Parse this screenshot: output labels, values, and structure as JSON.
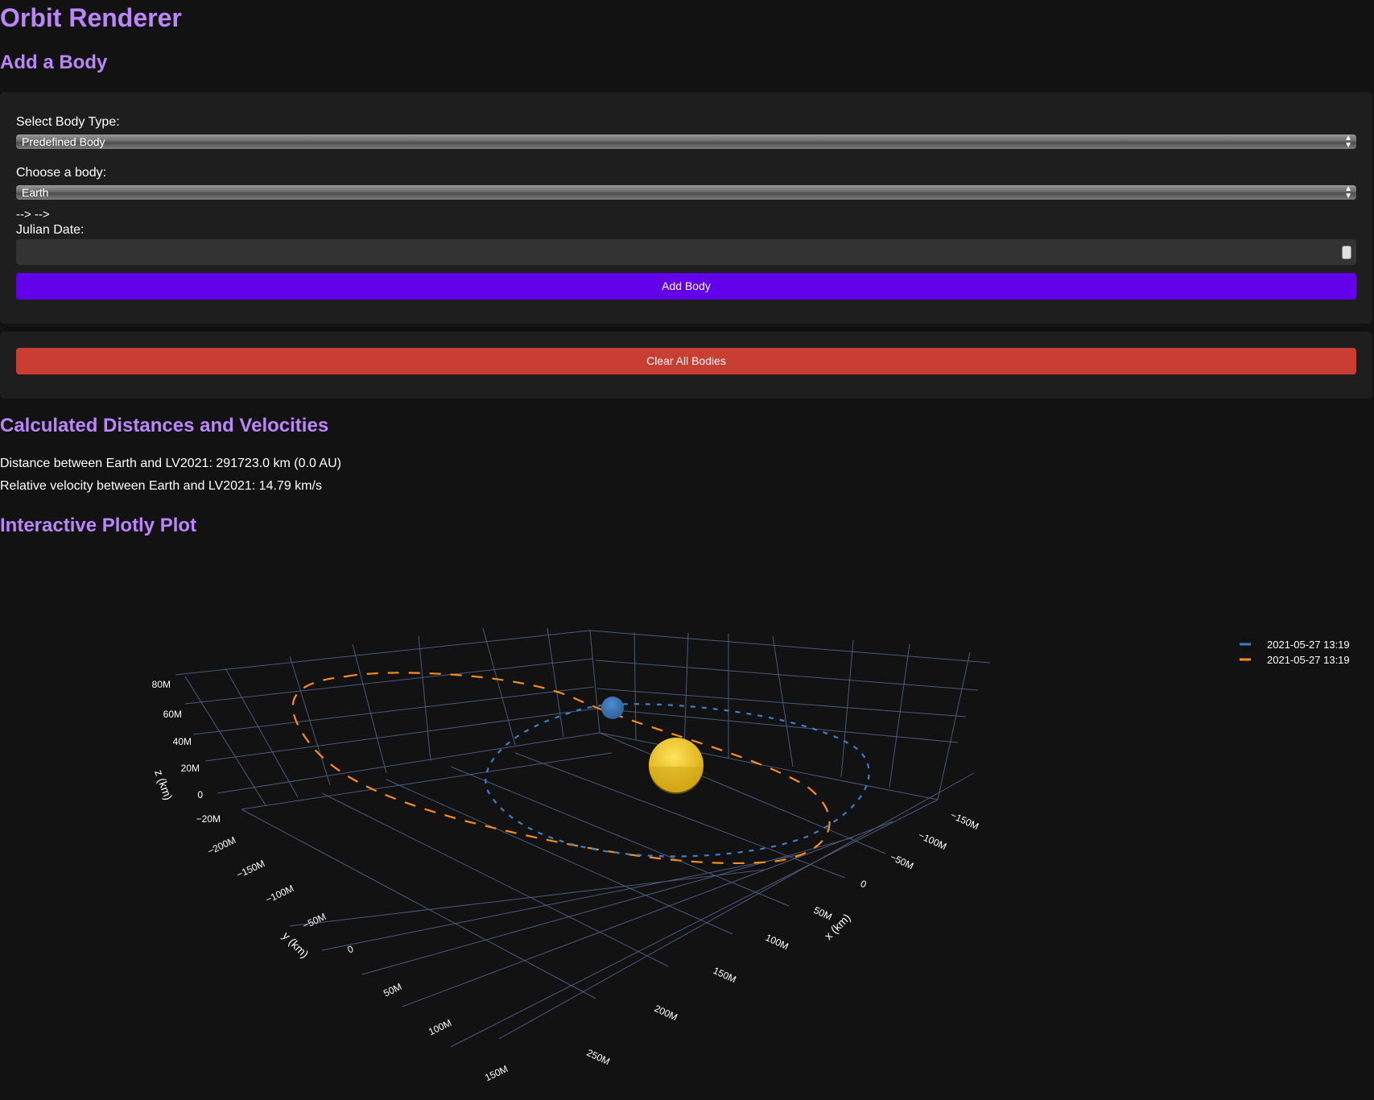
{
  "app": {
    "title": "Orbit Renderer"
  },
  "add_body": {
    "heading": "Add a Body",
    "body_type_label": "Select Body Type:",
    "body_type_value": "Predefined Body",
    "body_label": "Choose a body:",
    "body_value": "Earth",
    "stray_text": "--> -->",
    "julian_label": "Julian Date:",
    "julian_value": "",
    "add_button": "Add Body"
  },
  "clear": {
    "button": "Clear All Bodies"
  },
  "results": {
    "heading": "Calculated Distances and Velocities",
    "distance": "Distance between Earth and LV2021: 291723.0 km (0.0 AU)",
    "velocity": "Relative velocity between Earth and LV2021: 14.79 km/s"
  },
  "plot": {
    "heading": "Interactive Plotly Plot",
    "colors": {
      "earth_orbit": "#3a7fc9",
      "lv2021_orbit": "#ff8c1a",
      "sun": "#f5c518",
      "earth": "#3d74b8",
      "grid": "#4a5a7a"
    },
    "legend": [
      {
        "label": "2021-05-27 13:19",
        "color": "#3a7fc9"
      },
      {
        "label": "2021-05-27 13:19",
        "color": "#ff8c1a"
      }
    ],
    "axes": {
      "x": {
        "title": "x (km)",
        "ticks": [
          "−150M",
          "−100M",
          "−50M",
          "0",
          "50M",
          "100M",
          "150M",
          "200M",
          "250M"
        ]
      },
      "y": {
        "title": "y (km)",
        "ticks": [
          "−200M",
          "−150M",
          "−100M",
          "−50M",
          "0",
          "50M",
          "100M",
          "150M"
        ]
      },
      "z": {
        "title": "z (km)",
        "ticks": [
          "80M",
          "60M",
          "40M",
          "20M",
          "0",
          "−20M"
        ]
      }
    }
  }
}
